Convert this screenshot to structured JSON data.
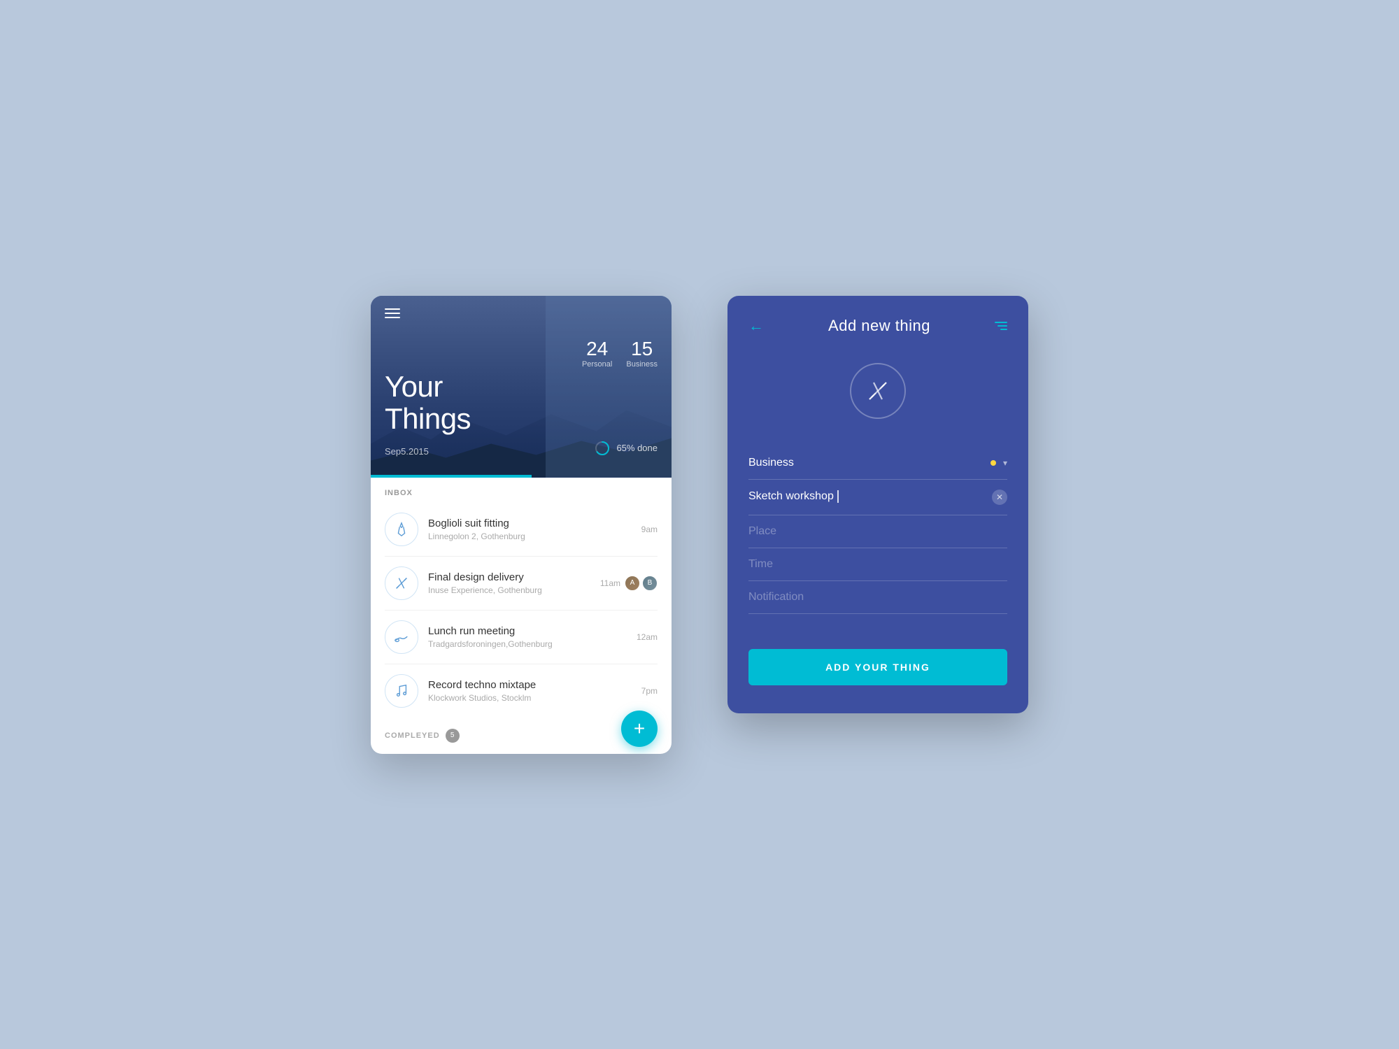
{
  "background": "#b8c8dc",
  "leftScreen": {
    "hero": {
      "title": "Your\nThings",
      "date": "Sep5.2015",
      "stats": [
        {
          "number": "24",
          "label": "Personal"
        },
        {
          "number": "15",
          "label": "Business"
        }
      ],
      "progress": "65% done"
    },
    "inbox": {
      "header": "INBOX",
      "items": [
        {
          "icon": "tie",
          "title": "Boglioli suit fitting",
          "subtitle": "Linnegolon 2, Gothenburg",
          "time": "9am",
          "avatars": []
        },
        {
          "icon": "design",
          "title": "Final design delivery",
          "subtitle": "Inuse Experience, Gothenburg",
          "time": "11am",
          "avatars": [
            "av1",
            "av2"
          ]
        },
        {
          "icon": "run",
          "title": "Lunch run meeting",
          "subtitle": "Tradgardsforoningen,Gothenburg",
          "time": "12am",
          "avatars": []
        },
        {
          "icon": "music",
          "title": "Record  techno mixtape",
          "subtitle": "Klockwork Studios, Stocklm",
          "time": "7pm",
          "avatars": []
        }
      ]
    },
    "completed": {
      "label": "COMPLEYED",
      "count": "5"
    },
    "fab": "+"
  },
  "rightScreen": {
    "header": {
      "back": "←",
      "title": "Add new thing",
      "filter": "filter"
    },
    "categoryIcon": "✏",
    "form": {
      "dropdown": {
        "label": "Business",
        "dot_color": "#ffd740"
      },
      "titleField": {
        "value": "Sketch workshop |",
        "placeholder": ""
      },
      "placeField": {
        "placeholder": "Place"
      },
      "timeField": {
        "placeholder": "Time"
      },
      "notificationField": {
        "placeholder": "Notification"
      }
    },
    "addButton": "ADD YOUR THING"
  }
}
